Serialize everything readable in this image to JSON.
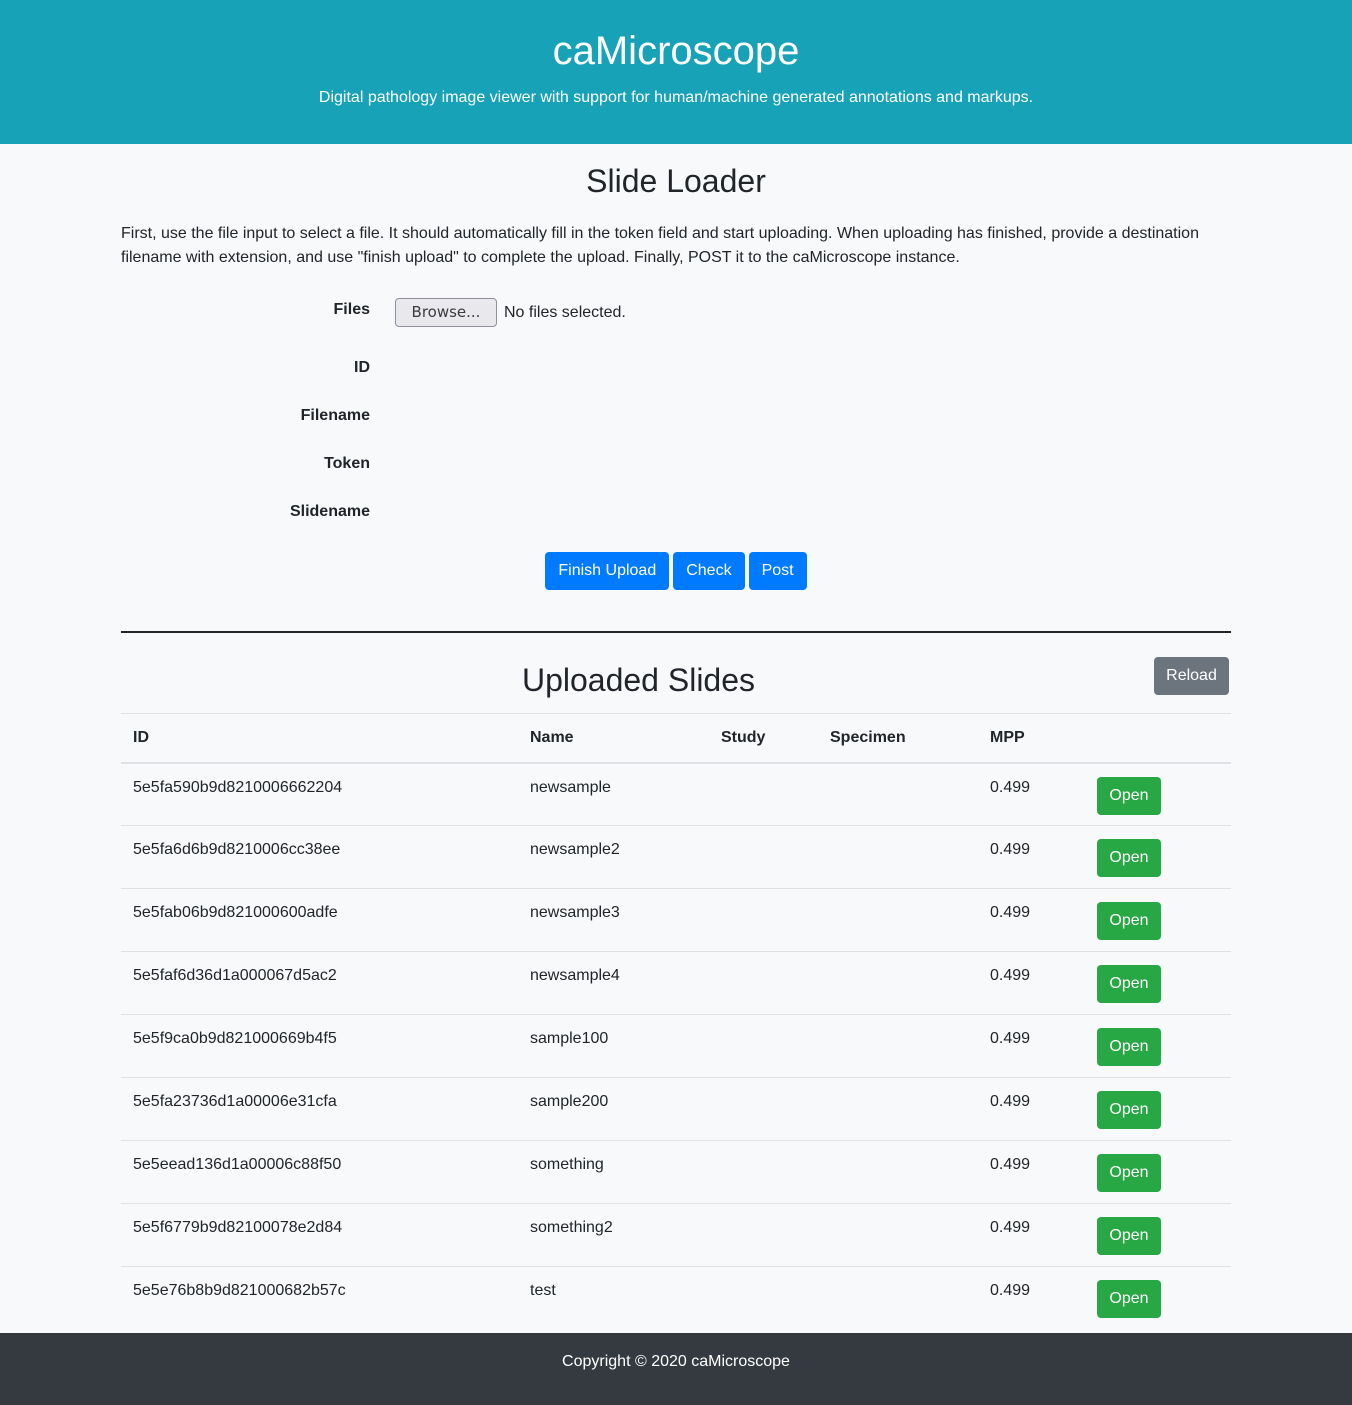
{
  "header": {
    "title": "caMicroscope",
    "subtitle": "Digital pathology image viewer with support for human/machine generated annotations and markups."
  },
  "loader": {
    "title": "Slide Loader",
    "intro": "First, use the file input to select a file. It should automatically fill in the token field and start uploading. When uploading has finished, provide a destination filename with extension, and use \"finish upload\" to complete the upload. Finally, POST it to the caMicroscope instance.",
    "files_label": "Files",
    "browse_label": "Browse...",
    "no_files_text": "No files selected.",
    "id_label": "ID",
    "filename_label": "Filename",
    "token_label": "Token",
    "slidename_label": "Slidename",
    "finish_upload_label": "Finish Upload",
    "check_label": "Check",
    "post_label": "Post"
  },
  "slides": {
    "title": "Uploaded Slides",
    "reload_label": "Reload",
    "columns": [
      "ID",
      "Name",
      "Study",
      "Specimen",
      "MPP",
      ""
    ],
    "open_label": "Open",
    "rows": [
      {
        "id": "5e5fa590b9d8210006662204",
        "name": "newsample",
        "study": "",
        "specimen": "",
        "mpp": "0.499"
      },
      {
        "id": "5e5fa6d6b9d8210006cc38ee",
        "name": "newsample2",
        "study": "",
        "specimen": "",
        "mpp": "0.499"
      },
      {
        "id": "5e5fab06b9d821000600adfe",
        "name": "newsample3",
        "study": "",
        "specimen": "",
        "mpp": "0.499"
      },
      {
        "id": "5e5faf6d36d1a000067d5ac2",
        "name": "newsample4",
        "study": "",
        "specimen": "",
        "mpp": "0.499"
      },
      {
        "id": "5e5f9ca0b9d821000669b4f5",
        "name": "sample100",
        "study": "",
        "specimen": "",
        "mpp": "0.499"
      },
      {
        "id": "5e5fa23736d1a00006e31cfa",
        "name": "sample200",
        "study": "",
        "specimen": "",
        "mpp": "0.499"
      },
      {
        "id": "5e5eead136d1a00006c88f50",
        "name": "something",
        "study": "",
        "specimen": "",
        "mpp": "0.499"
      },
      {
        "id": "5e5f6779b9d82100078e2d84",
        "name": "something2",
        "study": "",
        "specimen": "",
        "mpp": "0.499"
      },
      {
        "id": "5e5e76b8b9d821000682b57c",
        "name": "test",
        "study": "",
        "specimen": "",
        "mpp": "0.499"
      }
    ]
  },
  "footer": {
    "copyright": "Copyright © 2020 caMicroscope"
  },
  "colors": {
    "header_bg": "#17a2b8",
    "primary": "#007bff",
    "success": "#28a745",
    "secondary": "#6c757d",
    "footer_bg": "#343a40"
  }
}
